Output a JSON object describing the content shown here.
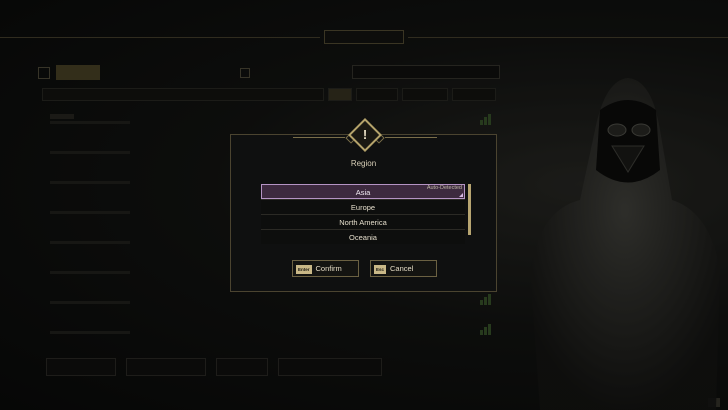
{
  "colors": {
    "accent_gold": "#b5a36b",
    "selection_purple": "#3d2a3f",
    "selection_border": "#b594c4"
  },
  "dialog": {
    "icon": "exclamation-icon",
    "title": "Region",
    "regions": [
      {
        "label": "Asia",
        "selected": true,
        "badge": "Auto-Detected"
      },
      {
        "label": "Europe",
        "selected": false
      },
      {
        "label": "North America",
        "selected": false
      },
      {
        "label": "Oceania",
        "selected": false
      }
    ],
    "confirm": {
      "key": "Enter",
      "label": "Confirm"
    },
    "cancel": {
      "key": "Esc",
      "label": "Cancel"
    }
  }
}
